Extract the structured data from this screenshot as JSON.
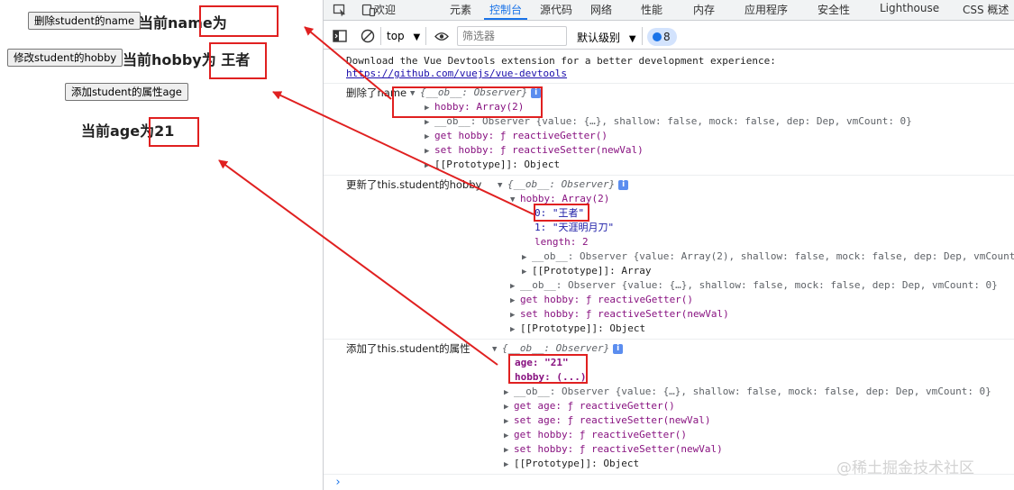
{
  "page": {
    "delete_button": "删除student的name",
    "current_name": "当前name为",
    "modify_button": "修改student的hobby",
    "current_hobby": "当前hobby为 王者",
    "add_button": "添加student的属性age",
    "current_age": "当前age为21"
  },
  "devtools": {
    "tabs": [
      "欢迎",
      "元素",
      "控制台",
      "源代码",
      "网络",
      "性能",
      "内存",
      "应用程序",
      "安全性",
      "Lighthouse",
      "CSS 概述"
    ],
    "active_tab": "控制台",
    "toolbar": {
      "context": "top",
      "filter_placeholder": "筛选器",
      "level": "默认级别",
      "issues_count": "8"
    },
    "console": {
      "devtools_msg": "Download the Vue Devtools extension for a better development experience:",
      "devtools_link": "https://github.com/vuejs/vue-devtools",
      "log1_label": "删除了name",
      "log1_head": "{__ob__: Observer}",
      "log1_hobby": "hobby: Array(2)",
      "log1_ob": "__ob__: Observer {value: {…}, shallow: false, mock: false, dep: Dep, vmCount: 0}",
      "log1_get": "get hobby: ƒ reactiveGetter()",
      "log1_set": "set hobby: ƒ reactiveSetter(newVal)",
      "log1_proto": "[[Prototype]]: Object",
      "log2_label": "更新了this.student的hobby",
      "log2_head": "{__ob__: Observer}",
      "log2_hobby": "hobby: Array(2)",
      "log2_item0": "0: \"王者\"",
      "log2_item1": "1: \"天涯明月刀\"",
      "log2_length": "length: 2",
      "log2_arr_ob": "__ob__: Observer {value: Array(2), shallow: false, mock: false, dep: Dep, vmCount: 0}",
      "log2_arr_proto": "[[Prototype]]: Array",
      "log2_ob": "__ob__: Observer {value: {…}, shallow: false, mock: false, dep: Dep, vmCount: 0}",
      "log2_get": "get hobby: ƒ reactiveGetter()",
      "log2_set": "set hobby: ƒ reactiveSetter(newVal)",
      "log2_proto": "[[Prototype]]: Object",
      "log3_label": "添加了this.student的属性",
      "log3_head": "{__ob__: Observer}",
      "log3_age": "age: \"21\"",
      "log3_hobby": "hobby: (...)",
      "log3_ob": "__ob__: Observer {value: {…}, shallow: false, mock: false, dep: Dep, vmCount: 0}",
      "log3_get_age": "get age: ƒ reactiveGetter()",
      "log3_set_age": "set age: ƒ reactiveSetter(newVal)",
      "log3_get_hobby": "get hobby: ƒ reactiveGetter()",
      "log3_set_hobby": "set hobby: ƒ reactiveSetter(newVal)",
      "log3_proto": "[[Prototype]]: Object",
      "prompt": "›"
    }
  },
  "watermark": "@稀土掘金技术社区",
  "colors": {
    "annotation": "#e02020",
    "accent": "#1a73e8"
  }
}
